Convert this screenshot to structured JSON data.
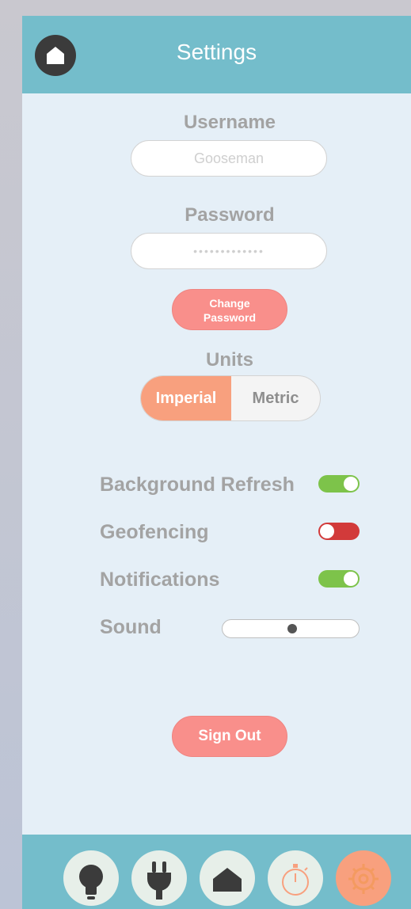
{
  "header": {
    "title": "Settings",
    "home_icon": "home-icon"
  },
  "account": {
    "username_label": "Username",
    "username_value": "Gooseman",
    "password_label": "Password",
    "password_value": "•••••••••••••",
    "change_password_line1": "Change",
    "change_password_line2": "Password"
  },
  "units": {
    "label": "Units",
    "options": [
      "Imperial",
      "Metric"
    ],
    "selected": "Imperial"
  },
  "preferences": [
    {
      "label": "Background Refresh",
      "type": "toggle",
      "on": true
    },
    {
      "label": "Geofencing",
      "type": "toggle",
      "on": false
    },
    {
      "label": "Notifications",
      "type": "toggle",
      "on": true
    },
    {
      "label": "Sound",
      "type": "slider",
      "value": 0.51
    }
  ],
  "sign_out_label": "Sign Out",
  "tabs": [
    {
      "icon": "lightbulb-icon",
      "active": false
    },
    {
      "icon": "plug-icon",
      "active": false
    },
    {
      "icon": "home-icon",
      "active": false
    },
    {
      "icon": "stopwatch-icon",
      "active": false
    },
    {
      "icon": "gear-icon",
      "active": true
    }
  ],
  "colors": {
    "header": "#74bdcb",
    "background": "#e5eff7",
    "accent": "#f98f8b",
    "selected_unit": "#f8a07e",
    "toggle_on": "#7dc34a",
    "toggle_off": "#d23a3a"
  }
}
